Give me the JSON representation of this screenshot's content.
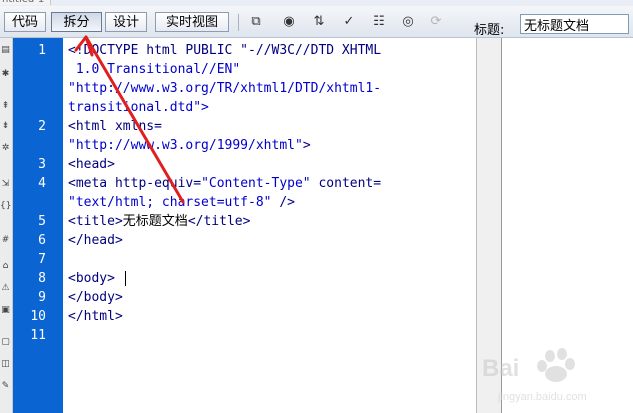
{
  "document_tab": {
    "label": "ntitled-1"
  },
  "toolbar": {
    "view_buttons": [
      {
        "label": "代码",
        "active": false
      },
      {
        "label": "拆分",
        "active": true
      },
      {
        "label": "设计",
        "active": false
      },
      {
        "label": "实时视图",
        "active": false
      }
    ],
    "icons": [
      {
        "name": "multiscreen-icon",
        "glyph": "⧉"
      },
      {
        "name": "preview-browser-icon",
        "glyph": "◉"
      },
      {
        "name": "file-management-icon",
        "glyph": "⇅"
      },
      {
        "name": "check-page-icon",
        "glyph": "✓"
      },
      {
        "name": "validate-markup-icon",
        "glyph": "☷"
      },
      {
        "name": "visual-aids-icon",
        "glyph": "◎"
      },
      {
        "name": "refresh-icon",
        "glyph": "⟳"
      }
    ],
    "title_label": "标题:",
    "title_value": "无标题文档"
  },
  "line_numbers": [
    "1",
    "2",
    "3",
    "4",
    "5",
    "6",
    "7",
    "8",
    "9",
    "10",
    "11"
  ],
  "code": {
    "l1a": "<!DOCTYPE html PUBLIC \"-//W3C//DTD XHTML",
    "l1b": " 1.0 Transitional//EN\"",
    "l1c": "\"http://www.w3.org/TR/xhtml1/DTD/xhtml1-",
    "l1d": "transitional.dtd\">",
    "l2a_tag": "<html xmlns=",
    "l2b_val": "\"http://www.w3.org/1999/xhtml\"",
    "l2b_tag": ">",
    "l3": "<head>",
    "l4a_tag": "<meta http-equiv=",
    "l4a_val": "\"Content-Type\"",
    "l4a_tag2": " content=",
    "l4b_val": "\"text/html; charset=utf-8\"",
    "l4b_tag": " />",
    "l5_open": "<title>",
    "l5_text": "无标题文档",
    "l5_close": "</title>",
    "l6": "</head>",
    "l8": "<body>",
    "l9": "</body>",
    "l10": "</html>"
  },
  "watermark": {
    "text": "Bai",
    "sub": "jingyan.baidu.com"
  },
  "colors": {
    "gutter": "#0a64d2",
    "tag": "#000080",
    "attr_value": "#0000cc",
    "annotation": "#e02020"
  }
}
